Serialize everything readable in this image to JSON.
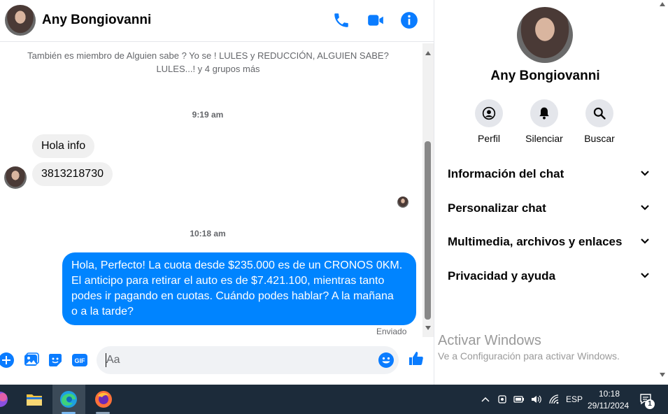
{
  "header": {
    "contact_name": "Any Bongiovanni"
  },
  "conversation": {
    "groups_line1": "También es miembro de Alguien sabe ? Yo se ! LULES y REDUCCIÓN, ALGUIEN SABE?",
    "groups_line2": "LULES...! y 4 grupos más",
    "timestamp_1": "9:19 am",
    "incoming_1": "Hola info",
    "incoming_2": "3813218730",
    "timestamp_2": "10:18 am",
    "outgoing_line1": "Hola, Perfecto! La cuota desde $235.000 es de un CRONOS 0KM.",
    "outgoing_line2": "El anticipo para retirar el auto es de $7.421.100, mientras tanto",
    "outgoing_line3": "podes ir pagando en cuotas. Cuándo podes hablar? A la mañana",
    "outgoing_line4": "o a la tarde?",
    "status": "Enviado"
  },
  "composer": {
    "placeholder": "Aa"
  },
  "side_panel": {
    "name": "Any Bongiovanni",
    "actions": [
      {
        "label": "Perfil",
        "icon": "profile-icon"
      },
      {
        "label": "Silenciar",
        "icon": "bell-icon"
      },
      {
        "label": "Buscar",
        "icon": "search-icon"
      }
    ],
    "sections": [
      {
        "label": "Información del chat"
      },
      {
        "label": "Personalizar chat"
      },
      {
        "label": "Multimedia, archivos y enlaces"
      },
      {
        "label": "Privacidad y ayuda"
      }
    ],
    "watermark_title": "Activar Windows",
    "watermark_sub": "Ve a Configuración para activar Windows."
  },
  "taskbar": {
    "language": "ESP",
    "time": "10:18",
    "date": "29/11/2024",
    "notification_count": "1"
  },
  "colors": {
    "accent": "#0084ff",
    "icon_blue": "#0a7cff",
    "taskbar_bg": "#1c2b3a"
  }
}
